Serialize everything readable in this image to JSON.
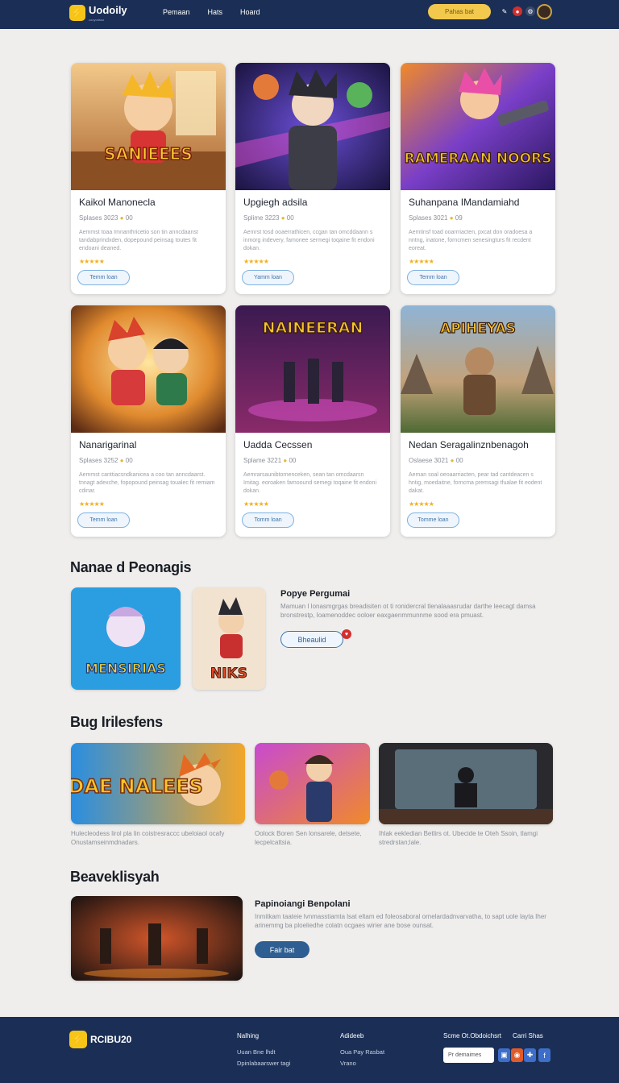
{
  "header": {
    "logo_text": "Uodoily",
    "logo_sub": "cooyodsso",
    "nav": [
      "Pemaan",
      "Hats",
      "Hoard"
    ],
    "cta": "Pahas bat"
  },
  "cards": [
    {
      "title": "Kaikol Manonecla",
      "meta": "Splases  3023",
      "coin": "00",
      "desc": "Aemmst toaa Imnanthricetio son tin anncdaanst tandabprindxden, dopepound peinsag toutes fit endoani deaned.",
      "rating": 5,
      "button": "Temm loan",
      "art_text": "SANIEEES"
    },
    {
      "title": "Upgiegh adsila",
      "meta": "Splime  3223",
      "coin": "00",
      "desc": "Aemrst tosd ooaerrathicen, ccgan tan omcddaann s inmorg indevery, famonee sermegi toqaine fit endoni dokan.",
      "rating": 5,
      "button": "Yamm loan",
      "art_text": ""
    },
    {
      "title": "Suhanpana IMandamiahd",
      "meta": "Splases  3021",
      "coin": "09",
      "desc": "Aemtinsf toad ooarrriacten, pxcat don oradoesa a nntng, inatone, forncmen senesingturs fit recdent eoreat.",
      "rating": 5,
      "button": "Temm loan",
      "art_text": "RAMERAAN NOORS"
    },
    {
      "title": "Nanarigarinal",
      "meta": "Splases  3252",
      "coin": "00",
      "desc": "Aemmst canttiacsndkanicea a coo tan anncdaarst. tnnagt adexche, fopopound peinsag toualec fit remiam cdinar.",
      "rating": 5,
      "button": "Temm loan",
      "art_text": ""
    },
    {
      "title": "Uadda Cecssen",
      "meta": "Splame  3221",
      "coin": "00",
      "desc": "Aemrarsaunibtornenceken, sean tan omcdaarsn  Imitag. eoroaken famoound semegi toqaine fit endoni dokan.",
      "rating": 5,
      "button": "Tomm loan",
      "art_text": "NAINEERAN"
    },
    {
      "title": "Nedan Seragalinznbenagoh",
      "meta": "Oslaese  3021",
      "coin": "00",
      "desc": "Aeman soal oeoaarriacten, pear tad cantdeacen s hntig, moedaitne, forncma premsagi tfualae fit eodent dakat.",
      "rating": 5,
      "button": "Tomme loan",
      "art_text": "APIHEYAS"
    }
  ],
  "section_new": {
    "heading": "Nanae d Peonagis",
    "promo_title": "Popye Pergumai",
    "promo_text": "Mamuan I lonasmgrgas breadisiten ot ti ronidercral tlenalaaasrudar darthe leecagt damsa bronstrestp, Ioamenoddec ooloer eaxgaenmmunnme sood era pmuast.",
    "promo_button": "Bheaulid",
    "tile1_text": "MENSIRIAS",
    "tile2_text": "NIKS"
  },
  "section_big": {
    "heading": "Bug Irilesfens",
    "tile1_text": "HDAE NALEES",
    "cap1": "Hulecleodess lirol pla lin coistresraccc ubeloiaol ocafy Onustamseinmdnadars.",
    "cap2": "Oolock Boren Sen lonsarele, detsete, lecpelcattsia.",
    "cap3": "Ihlak eekledian Betlirs ot. Ubecide te Oteh Ssoin, tlamgi stredrstan;lale."
  },
  "section_weekly": {
    "heading": "Beaveklisyah",
    "title": "Papinoiangi Benpolani",
    "text": "Inmitkam taateie lvnmasstiamta lsat eltam ed foleosaboral ornelardadnvarvatha, to sapt uole layta Iher arinemmg ba ploeliedhe colatn ocgaes wirier ane bose ounsat.",
    "button": "Fair bat"
  },
  "footer": {
    "logo_text": "RCIBU20",
    "col1_title": "Nalhing",
    "col1_items": [
      "Uuan Bne lhdt",
      "Dpinlabaarswer tagi"
    ],
    "col2_title": "Adideeb",
    "col2_items": [
      "Oua Pay Rasbat",
      "Vrano"
    ],
    "col3_title": "Scme  Ot.Obdoichsrt",
    "col4_title": "Carri  Shas",
    "input_placeholder": "Pr demaimes"
  },
  "colors": {
    "navy": "#1b2f56",
    "accent": "#f2c94c",
    "page_bg": "#efeeec",
    "star": "#f2b01e"
  }
}
